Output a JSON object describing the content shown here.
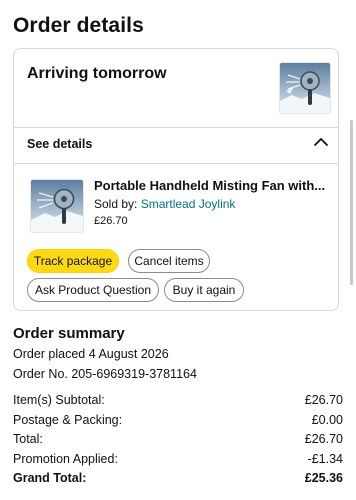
{
  "page": {
    "title": "Order details"
  },
  "shipment": {
    "status": "Arriving tomorrow",
    "see_details_label": "See details"
  },
  "item": {
    "title": "Portable Handheld Misting Fan with...",
    "sold_by_label": "Sold by:",
    "seller": "Smartlead Joylink",
    "price": "£26.70"
  },
  "actions": {
    "track": "Track package",
    "cancel": "Cancel items",
    "ask": "Ask Product Question",
    "buy_again": "Buy it again"
  },
  "summary": {
    "title": "Order summary",
    "placed": "Order placed 4 August 2026",
    "order_no": "Order No. 205-6969319-3781164",
    "rows": [
      {
        "label": "Item(s) Subtotal:",
        "value": "£26.70"
      },
      {
        "label": "Postage & Packing:",
        "value": "£0.00"
      },
      {
        "label": "Total:",
        "value": "£26.70"
      },
      {
        "label": "Promotion Applied:",
        "value": "-£1.34"
      },
      {
        "label": "Grand Total:",
        "value": "£25.36"
      }
    ]
  },
  "colors": {
    "accent_button": "#ffd814",
    "link": "#007185",
    "border": "#d5d9d9"
  },
  "icons": {
    "collapse": "chevron-up-icon",
    "product_image": "misting-fan-image"
  }
}
